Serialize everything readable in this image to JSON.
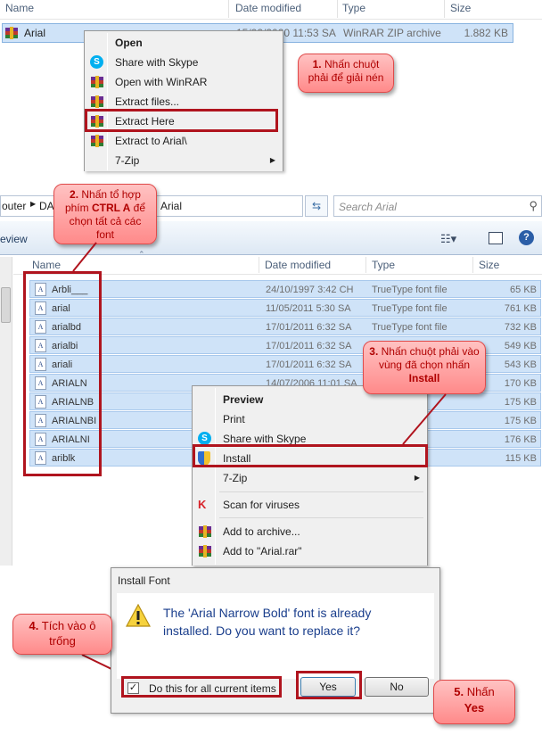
{
  "panel1": {
    "headers": {
      "name": "Name",
      "date": "Date modified",
      "type": "Type",
      "size": "Size"
    },
    "file": {
      "name": "Arial",
      "date": "15/02/2020 11:53 SA",
      "type": "WinRAR ZIP archive",
      "size": "1.882 KB"
    },
    "menu": [
      {
        "label": "Open",
        "bold": true,
        "icon": ""
      },
      {
        "label": "Share with Skype",
        "icon": "skype-icon"
      },
      {
        "label": "Open with WinRAR",
        "icon": "winrar-icon"
      },
      {
        "label": "Extract files...",
        "icon": "winrar-icon"
      },
      {
        "label": "Extract Here",
        "icon": "winrar-icon"
      },
      {
        "label": "Extract to Arial\\",
        "icon": "winrar-icon"
      },
      {
        "label": "7-Zip",
        "icon": "",
        "submenu": true
      }
    ],
    "callout_num": "1.",
    "callout_text": "Nhấn chuột phải để giải nén"
  },
  "panel2": {
    "breadcrumb_left": "outer",
    "breadcrumb_mid": "DA",
    "breadcrumb_end": "Arial",
    "search_placeholder": "Search Arial",
    "toolbar_view": "eview",
    "headers": {
      "name": "Name",
      "date": "Date modified",
      "type": "Type",
      "size": "Size"
    },
    "files": [
      {
        "name": "Arbli___",
        "date": "24/10/1997 3:42 CH",
        "type": "TrueType font file",
        "size": "65 KB"
      },
      {
        "name": "arial",
        "date": "11/05/2011 5:30 SA",
        "type": "TrueType font file",
        "size": "761 KB"
      },
      {
        "name": "arialbd",
        "date": "17/01/2011 6:32 SA",
        "type": "TrueType font file",
        "size": "732 KB"
      },
      {
        "name": "arialbi",
        "date": "17/01/2011 6:32 SA",
        "type": "TrueType font file",
        "size": "549 KB"
      },
      {
        "name": "ariali",
        "date": "17/01/2011 6:32 SA",
        "type": "TrueType font file",
        "size": "543 KB"
      },
      {
        "name": "ARIALN",
        "date": "14/07/2006 11:01 SA",
        "type": "",
        "size": "170 KB"
      },
      {
        "name": "ARIALNB",
        "date": "",
        "type": "",
        "size": "175 KB"
      },
      {
        "name": "ARIALNBI",
        "date": "",
        "type": "",
        "size": "175 KB"
      },
      {
        "name": "ARIALNI",
        "date": "",
        "type": "",
        "size": "176 KB"
      },
      {
        "name": "ariblk",
        "date": "",
        "type": "",
        "size": "115 KB"
      }
    ],
    "menu": [
      {
        "label": "Preview",
        "bold": true
      },
      {
        "label": "Print"
      },
      {
        "label": "Share with Skype",
        "icon": "skype-icon"
      },
      {
        "label": "Install",
        "icon": "shield-icon"
      },
      {
        "label": "7-Zip",
        "submenu": true
      },
      {
        "label": "Scan for viruses",
        "icon": "antivirus-icon"
      },
      {
        "label": "Add to archive...",
        "icon": "winrar-icon"
      },
      {
        "label": "Add to \"Arial.rar\"",
        "icon": "winrar-icon"
      }
    ],
    "callout2_num": "2.",
    "callout2_pre": "Nhấn tổ hợp phím",
    "callout2_key": "CTRL A",
    "callout2_post": "để chọn tất cả các font",
    "callout3_num": "3.",
    "callout3_pre": "Nhấn chuột phải vào vùng đã chọn nhấn",
    "callout3_key": "Install"
  },
  "dialog": {
    "title": "Install Font",
    "message": "The 'Arial Narrow Bold' font is already installed. Do you want to replace it?",
    "checkbox_label": "Do this for all current items",
    "checkbox_checked": true,
    "yes_label": "Yes",
    "no_label": "No",
    "callout4_num": "4.",
    "callout4_text": "Tích vào ô trống",
    "callout5_num": "5.",
    "callout5_pre": "Nhấn",
    "callout5_key": "Yes"
  }
}
